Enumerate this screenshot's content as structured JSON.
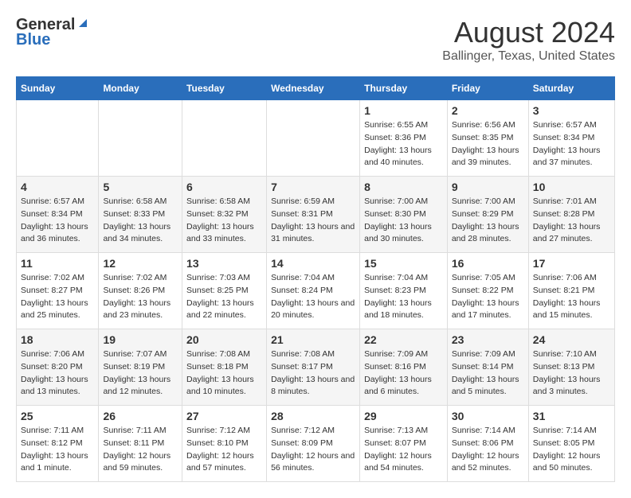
{
  "header": {
    "logo_general": "General",
    "logo_blue": "Blue",
    "title": "August 2024",
    "subtitle": "Ballinger, Texas, United States"
  },
  "days_of_week": [
    "Sunday",
    "Monday",
    "Tuesday",
    "Wednesday",
    "Thursday",
    "Friday",
    "Saturday"
  ],
  "weeks": [
    {
      "days": [
        {
          "num": "",
          "empty": true
        },
        {
          "num": "",
          "empty": true
        },
        {
          "num": "",
          "empty": true
        },
        {
          "num": "",
          "empty": true
        },
        {
          "num": "1",
          "sunrise": "6:55 AM",
          "sunset": "8:36 PM",
          "daylight": "13 hours and 40 minutes."
        },
        {
          "num": "2",
          "sunrise": "6:56 AM",
          "sunset": "8:35 PM",
          "daylight": "13 hours and 39 minutes."
        },
        {
          "num": "3",
          "sunrise": "6:57 AM",
          "sunset": "8:34 PM",
          "daylight": "13 hours and 37 minutes."
        }
      ]
    },
    {
      "days": [
        {
          "num": "4",
          "sunrise": "6:57 AM",
          "sunset": "8:34 PM",
          "daylight": "13 hours and 36 minutes."
        },
        {
          "num": "5",
          "sunrise": "6:58 AM",
          "sunset": "8:33 PM",
          "daylight": "13 hours and 34 minutes."
        },
        {
          "num": "6",
          "sunrise": "6:58 AM",
          "sunset": "8:32 PM",
          "daylight": "13 hours and 33 minutes."
        },
        {
          "num": "7",
          "sunrise": "6:59 AM",
          "sunset": "8:31 PM",
          "daylight": "13 hours and 31 minutes."
        },
        {
          "num": "8",
          "sunrise": "7:00 AM",
          "sunset": "8:30 PM",
          "daylight": "13 hours and 30 minutes."
        },
        {
          "num": "9",
          "sunrise": "7:00 AM",
          "sunset": "8:29 PM",
          "daylight": "13 hours and 28 minutes."
        },
        {
          "num": "10",
          "sunrise": "7:01 AM",
          "sunset": "8:28 PM",
          "daylight": "13 hours and 27 minutes."
        }
      ]
    },
    {
      "days": [
        {
          "num": "11",
          "sunrise": "7:02 AM",
          "sunset": "8:27 PM",
          "daylight": "13 hours and 25 minutes."
        },
        {
          "num": "12",
          "sunrise": "7:02 AM",
          "sunset": "8:26 PM",
          "daylight": "13 hours and 23 minutes."
        },
        {
          "num": "13",
          "sunrise": "7:03 AM",
          "sunset": "8:25 PM",
          "daylight": "13 hours and 22 minutes."
        },
        {
          "num": "14",
          "sunrise": "7:04 AM",
          "sunset": "8:24 PM",
          "daylight": "13 hours and 20 minutes."
        },
        {
          "num": "15",
          "sunrise": "7:04 AM",
          "sunset": "8:23 PM",
          "daylight": "13 hours and 18 minutes."
        },
        {
          "num": "16",
          "sunrise": "7:05 AM",
          "sunset": "8:22 PM",
          "daylight": "13 hours and 17 minutes."
        },
        {
          "num": "17",
          "sunrise": "7:06 AM",
          "sunset": "8:21 PM",
          "daylight": "13 hours and 15 minutes."
        }
      ]
    },
    {
      "days": [
        {
          "num": "18",
          "sunrise": "7:06 AM",
          "sunset": "8:20 PM",
          "daylight": "13 hours and 13 minutes."
        },
        {
          "num": "19",
          "sunrise": "7:07 AM",
          "sunset": "8:19 PM",
          "daylight": "13 hours and 12 minutes."
        },
        {
          "num": "20",
          "sunrise": "7:08 AM",
          "sunset": "8:18 PM",
          "daylight": "13 hours and 10 minutes."
        },
        {
          "num": "21",
          "sunrise": "7:08 AM",
          "sunset": "8:17 PM",
          "daylight": "13 hours and 8 minutes."
        },
        {
          "num": "22",
          "sunrise": "7:09 AM",
          "sunset": "8:16 PM",
          "daylight": "13 hours and 6 minutes."
        },
        {
          "num": "23",
          "sunrise": "7:09 AM",
          "sunset": "8:14 PM",
          "daylight": "13 hours and 5 minutes."
        },
        {
          "num": "24",
          "sunrise": "7:10 AM",
          "sunset": "8:13 PM",
          "daylight": "13 hours and 3 minutes."
        }
      ]
    },
    {
      "days": [
        {
          "num": "25",
          "sunrise": "7:11 AM",
          "sunset": "8:12 PM",
          "daylight": "13 hours and 1 minute."
        },
        {
          "num": "26",
          "sunrise": "7:11 AM",
          "sunset": "8:11 PM",
          "daylight": "12 hours and 59 minutes."
        },
        {
          "num": "27",
          "sunrise": "7:12 AM",
          "sunset": "8:10 PM",
          "daylight": "12 hours and 57 minutes."
        },
        {
          "num": "28",
          "sunrise": "7:12 AM",
          "sunset": "8:09 PM",
          "daylight": "12 hours and 56 minutes."
        },
        {
          "num": "29",
          "sunrise": "7:13 AM",
          "sunset": "8:07 PM",
          "daylight": "12 hours and 54 minutes."
        },
        {
          "num": "30",
          "sunrise": "7:14 AM",
          "sunset": "8:06 PM",
          "daylight": "12 hours and 52 minutes."
        },
        {
          "num": "31",
          "sunrise": "7:14 AM",
          "sunset": "8:05 PM",
          "daylight": "12 hours and 50 minutes."
        }
      ]
    }
  ],
  "labels": {
    "sunrise_prefix": "Sunrise: ",
    "sunset_prefix": "Sunset: ",
    "daylight_prefix": "Daylight: "
  }
}
